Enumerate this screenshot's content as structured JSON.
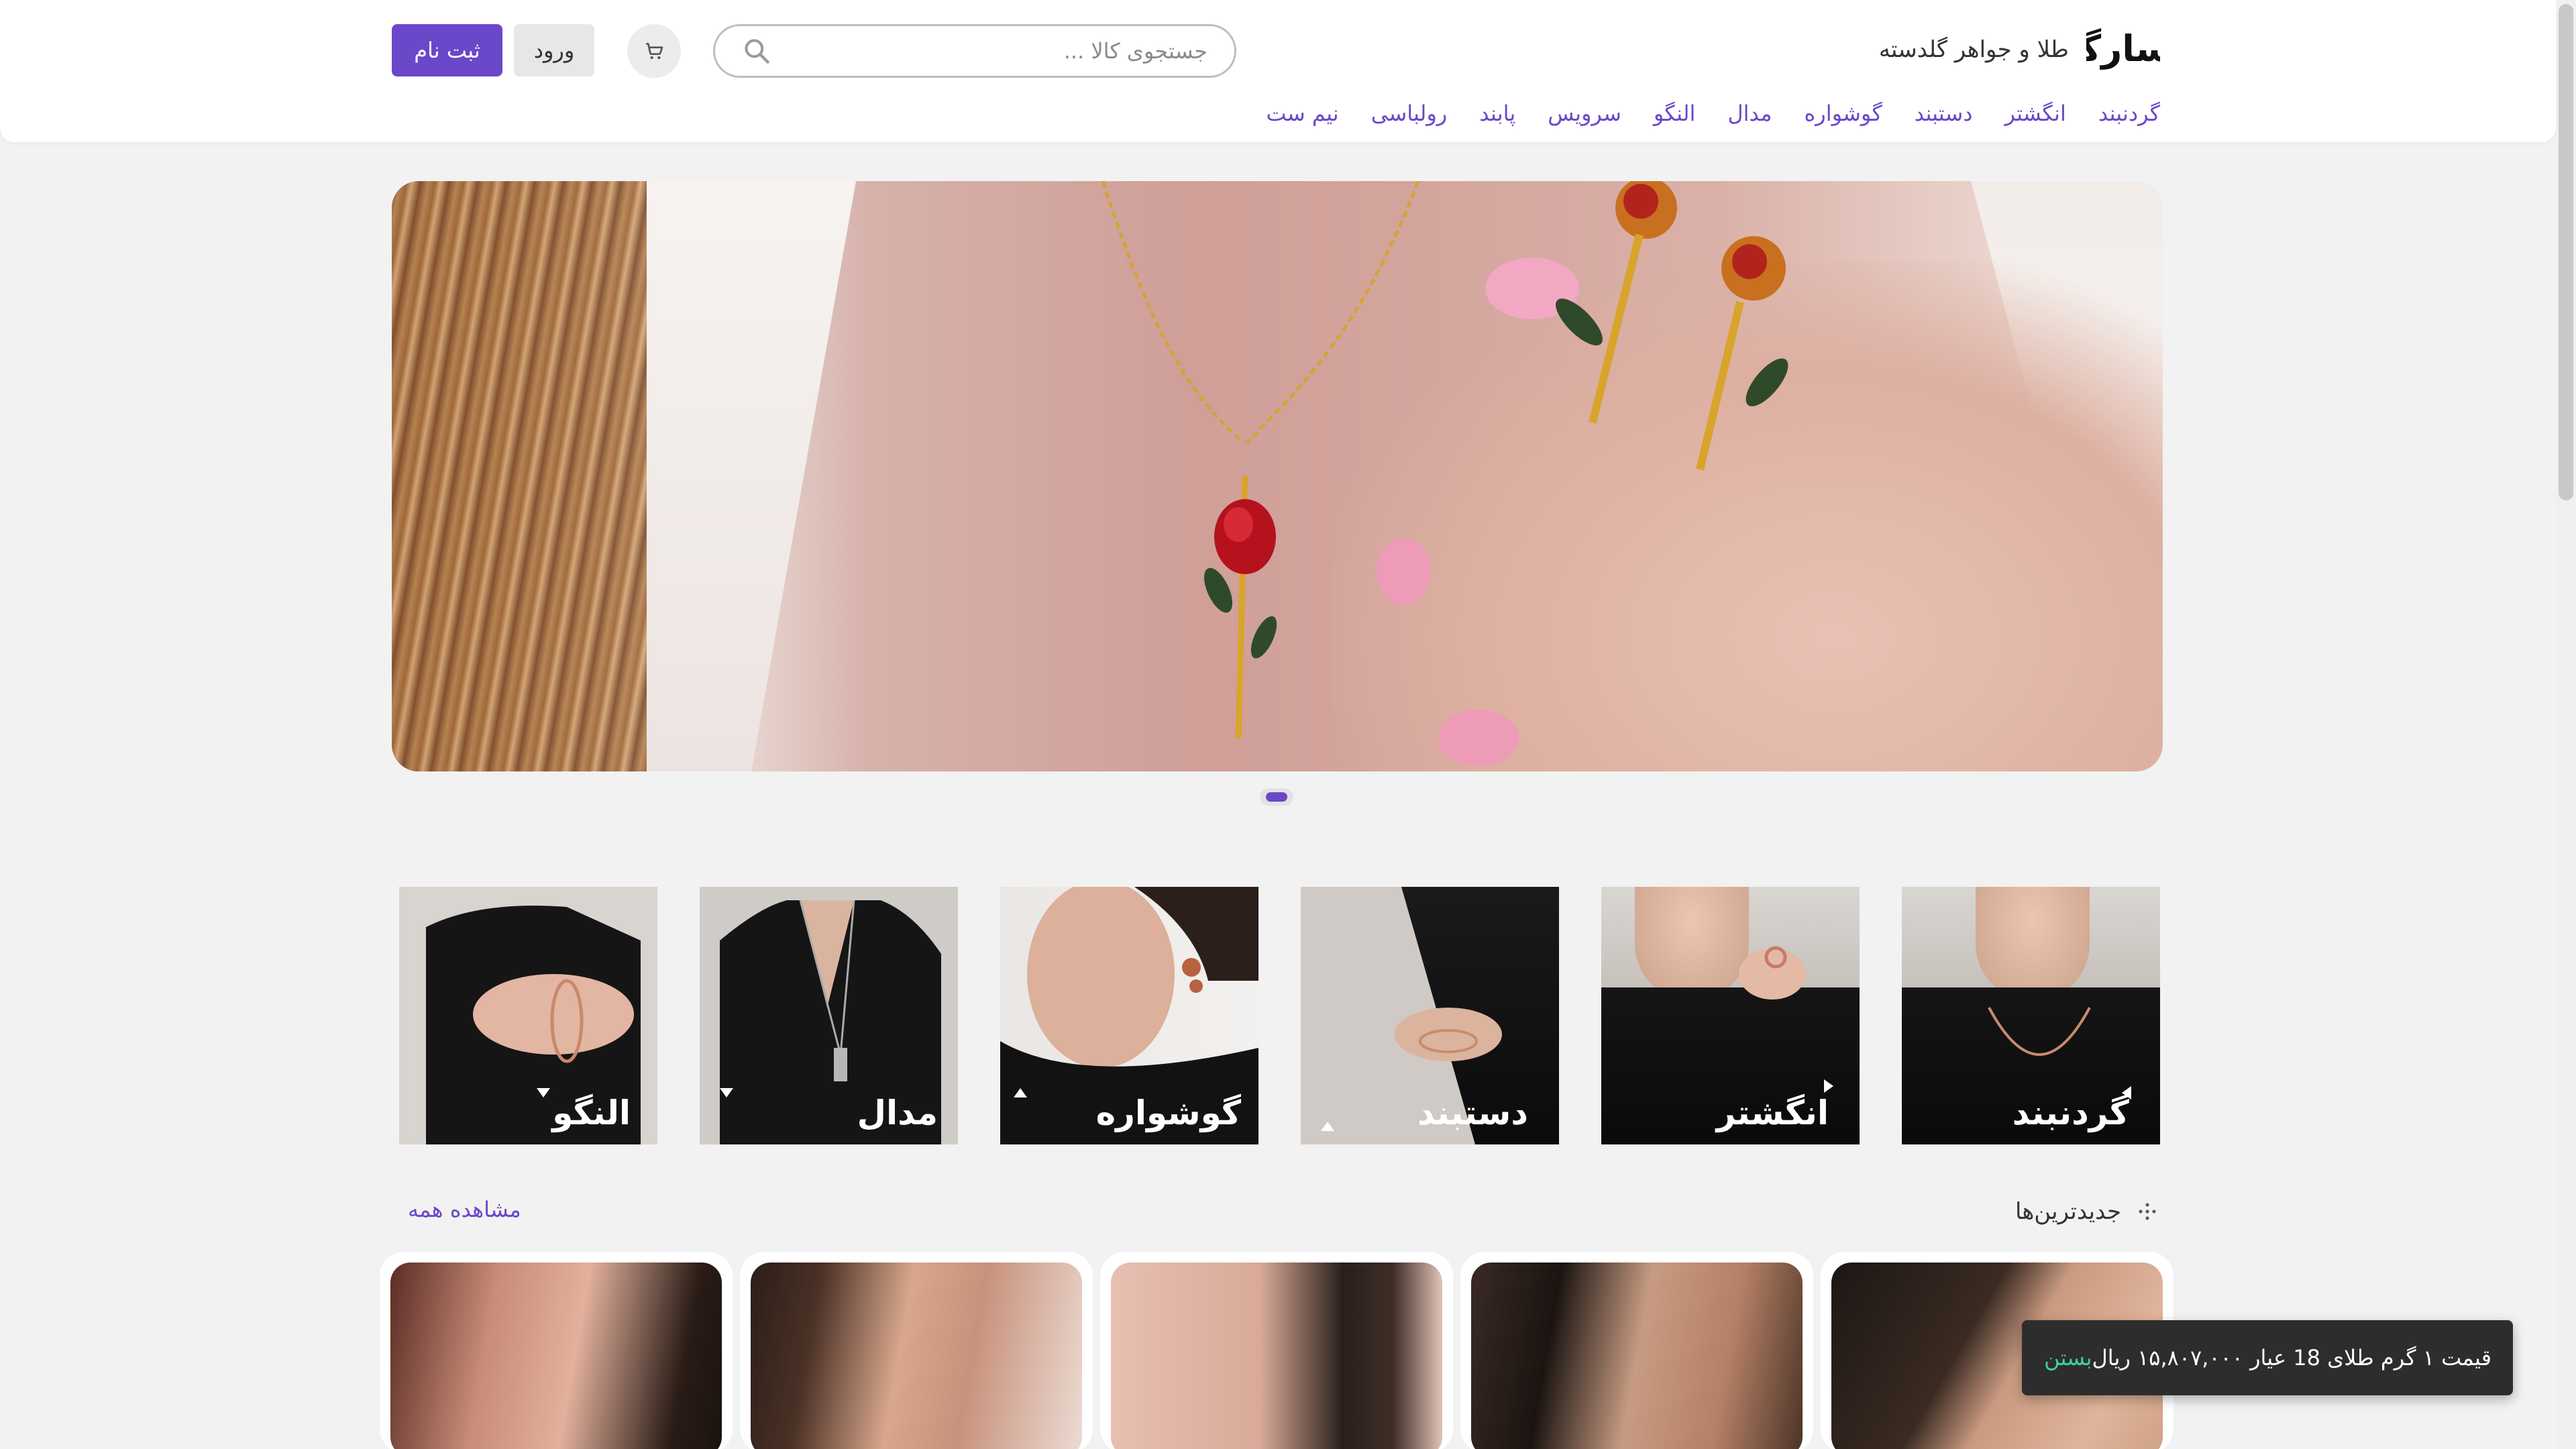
{
  "brand": {
    "logo_text": "پاسارگاد",
    "name": "طلا و جواهر گلدسته"
  },
  "search": {
    "placeholder": "جستجوی کالا ...",
    "icon": "search-icon"
  },
  "header": {
    "cart_icon": "cart-icon",
    "login_label": "ورود",
    "signup_label": "ثبت نام"
  },
  "nav": {
    "items": [
      "گردنبند",
      "انگشتر",
      "دستبند",
      "گوشواره",
      "مدال",
      "النگو",
      "سرویس",
      "پابند",
      "رولباسی",
      "نیم ست"
    ]
  },
  "hero": {
    "slides_count": 1,
    "active_slide": 1
  },
  "categories": {
    "items": [
      {
        "label": "گردنبند"
      },
      {
        "label": "انگشتر"
      },
      {
        "label": "دستبند"
      },
      {
        "label": "گوشواره"
      },
      {
        "label": "مدال"
      },
      {
        "label": "النگو"
      }
    ]
  },
  "newest": {
    "title": "جدیدترین‌ها",
    "see_all": "مشاهده همه",
    "icon": "dots-grid-icon"
  },
  "toast": {
    "message": "قیمت ۱ گرم طلای 18 عیار ۱۵,۸۰۷,۰۰۰ ریال",
    "close_label": "بستن"
  },
  "colors": {
    "accent": "#6b47c9",
    "toast_bg": "#2d2d2d",
    "toast_action": "#3ad29f",
    "page_bg": "#f2f2f2"
  }
}
